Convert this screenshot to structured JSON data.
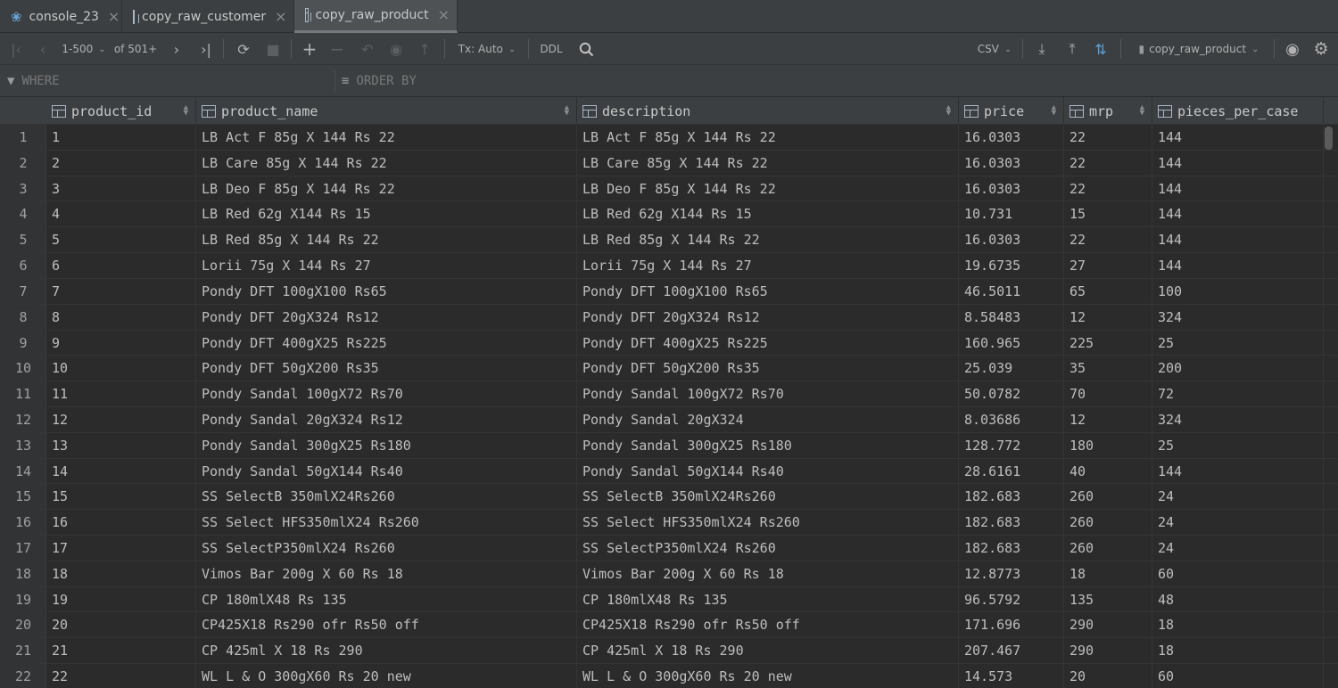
{
  "tabs": [
    {
      "label": "console_23",
      "icon": "postgres-elephant-icon",
      "active": false
    },
    {
      "label": "copy_raw_customer",
      "icon": "table-icon",
      "active": false
    },
    {
      "label": "copy_raw_product",
      "icon": "table-icon",
      "active": true
    }
  ],
  "toolbar": {
    "range": "1-500",
    "of_total": "of 501+",
    "tx_mode": "Tx: Auto",
    "ddl": "DDL",
    "export_format": "CSV",
    "target_table": "copy_raw_product"
  },
  "filters": {
    "where": "WHERE",
    "order_by": "ORDER BY"
  },
  "columns": [
    "product_id",
    "product_name",
    "description",
    "price",
    "mrp",
    "pieces_per_case"
  ],
  "rows": [
    {
      "n": "1",
      "c": [
        "1",
        "LB Act F 85g X 144 Rs 22",
        "LB Act F 85g X 144 Rs 22",
        "16.0303",
        "22",
        "144"
      ]
    },
    {
      "n": "2",
      "c": [
        "2",
        "LB Care 85g X 144 Rs 22",
        "LB Care 85g X 144 Rs 22",
        "16.0303",
        "22",
        "144"
      ]
    },
    {
      "n": "3",
      "c": [
        "3",
        "LB Deo F 85g X 144 Rs 22",
        "LB Deo F 85g X 144 Rs 22",
        "16.0303",
        "22",
        "144"
      ]
    },
    {
      "n": "4",
      "c": [
        "4",
        "LB Red 62g X144 Rs 15",
        "LB Red 62g X144 Rs 15",
        "10.731",
        "15",
        "144"
      ]
    },
    {
      "n": "5",
      "c": [
        "5",
        "LB Red 85g X 144 Rs 22",
        "LB Red 85g X 144 Rs 22",
        "16.0303",
        "22",
        "144"
      ]
    },
    {
      "n": "6",
      "c": [
        "6",
        "Lorii 75g X 144 Rs 27",
        "Lorii 75g X 144 Rs 27",
        "19.6735",
        "27",
        "144"
      ]
    },
    {
      "n": "7",
      "c": [
        "7",
        "Pondy DFT 100gX100 Rs65",
        "Pondy DFT 100gX100 Rs65",
        "46.5011",
        "65",
        "100"
      ]
    },
    {
      "n": "8",
      "c": [
        "8",
        "Pondy DFT 20gX324 Rs12",
        "Pondy DFT 20gX324 Rs12",
        "8.58483",
        "12",
        "324"
      ]
    },
    {
      "n": "9",
      "c": [
        "9",
        "Pondy DFT 400gX25 Rs225",
        "Pondy DFT 400gX25 Rs225",
        "160.965",
        "225",
        "25"
      ]
    },
    {
      "n": "10",
      "c": [
        "10",
        "Pondy DFT 50gX200 Rs35",
        "Pondy DFT 50gX200 Rs35",
        "25.039",
        "35",
        "200"
      ]
    },
    {
      "n": "11",
      "c": [
        "11",
        "Pondy Sandal 100gX72 Rs70",
        "Pondy Sandal 100gX72 Rs70",
        "50.0782",
        "70",
        "72"
      ]
    },
    {
      "n": "12",
      "c": [
        "12",
        "Pondy Sandal 20gX324 Rs12",
        "Pondy Sandal 20gX324",
        "8.03686",
        "12",
        "324"
      ]
    },
    {
      "n": "13",
      "c": [
        "13",
        "Pondy Sandal 300gX25 Rs180",
        "Pondy Sandal 300gX25 Rs180",
        "128.772",
        "180",
        "25"
      ]
    },
    {
      "n": "14",
      "c": [
        "14",
        "Pondy Sandal 50gX144 Rs40",
        "Pondy Sandal 50gX144 Rs40",
        "28.6161",
        "40",
        "144"
      ]
    },
    {
      "n": "15",
      "c": [
        "15",
        "SS SelectB 350mlX24Rs260",
        "SS SelectB 350mlX24Rs260",
        "182.683",
        "260",
        "24"
      ]
    },
    {
      "n": "16",
      "c": [
        "16",
        "SS Select HFS350mlX24 Rs260",
        "SS Select HFS350mlX24 Rs260",
        "182.683",
        "260",
        "24"
      ]
    },
    {
      "n": "17",
      "c": [
        "17",
        "SS SelectP350mlX24 Rs260",
        "SS SelectP350mlX24 Rs260",
        "182.683",
        "260",
        "24"
      ]
    },
    {
      "n": "18",
      "c": [
        "18",
        "Vimos Bar 200g X 60 Rs 18",
        "Vimos Bar 200g X 60 Rs 18",
        "12.8773",
        "18",
        "60"
      ]
    },
    {
      "n": "19",
      "c": [
        "19",
        "CP 180mlX48 Rs 135",
        "CP 180mlX48 Rs 135",
        "96.5792",
        "135",
        "48"
      ]
    },
    {
      "n": "20",
      "c": [
        "20",
        "CP425X18 Rs290 ofr Rs50 off",
        "CP425X18 Rs290 ofr Rs50 off",
        "171.696",
        "290",
        "18"
      ]
    },
    {
      "n": "21",
      "c": [
        "21",
        "CP 425ml X 18 Rs 290",
        "CP 425ml X 18 Rs 290",
        "207.467",
        "290",
        "18"
      ]
    },
    {
      "n": "22",
      "c": [
        "22",
        "WL L & O 300gX60 Rs 20 new",
        "WL L & O 300gX60 Rs 20 new",
        "14.573",
        "20",
        "60"
      ]
    }
  ]
}
